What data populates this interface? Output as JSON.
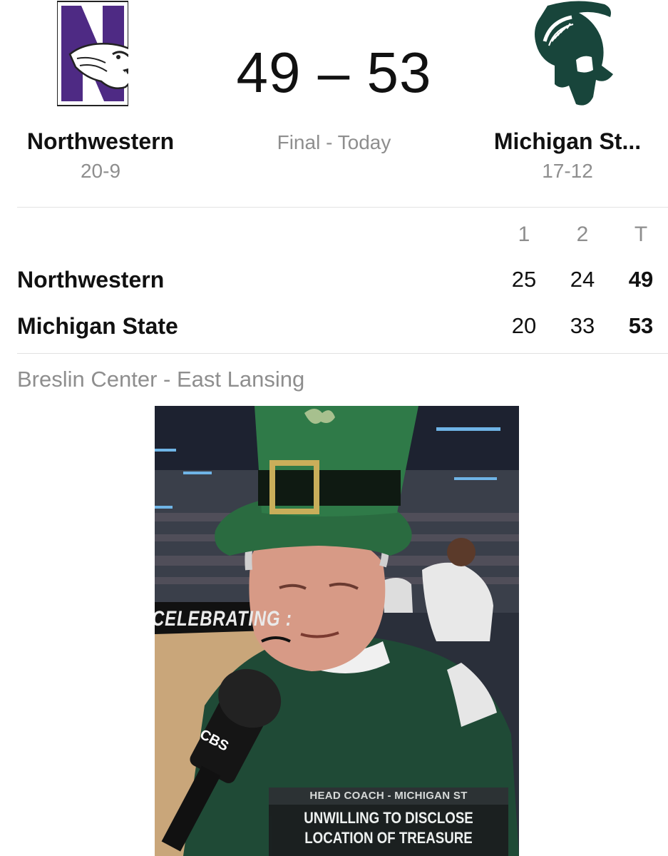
{
  "game": {
    "score": "49 – 53",
    "status": "Final - Today",
    "home": {
      "name": "Northwestern",
      "record": "20-9"
    },
    "away": {
      "name": "Michigan St...",
      "record": "17-12"
    }
  },
  "linescore": {
    "headers": [
      "1",
      "2",
      "T"
    ],
    "rows": [
      {
        "team": "Northwestern",
        "q1": "25",
        "q2": "24",
        "total": "49"
      },
      {
        "team": "Michigan State",
        "q1": "20",
        "q2": "33",
        "total": "53"
      }
    ]
  },
  "venue": "Breslin Center - East Lansing",
  "photo": {
    "banner_text": "CELEBRATING :",
    "mic_flag": "CBS",
    "lower_third": {
      "title": "HEAD COACH - MICHIGAN ST",
      "line1": "UNWILLING TO DISCLOSE",
      "line2": "LOCATION OF TREASURE"
    }
  },
  "colors": {
    "northwestern_purple": "#4E2A84",
    "msu_green": "#18453B",
    "muted_text": "#8e8e8e"
  }
}
